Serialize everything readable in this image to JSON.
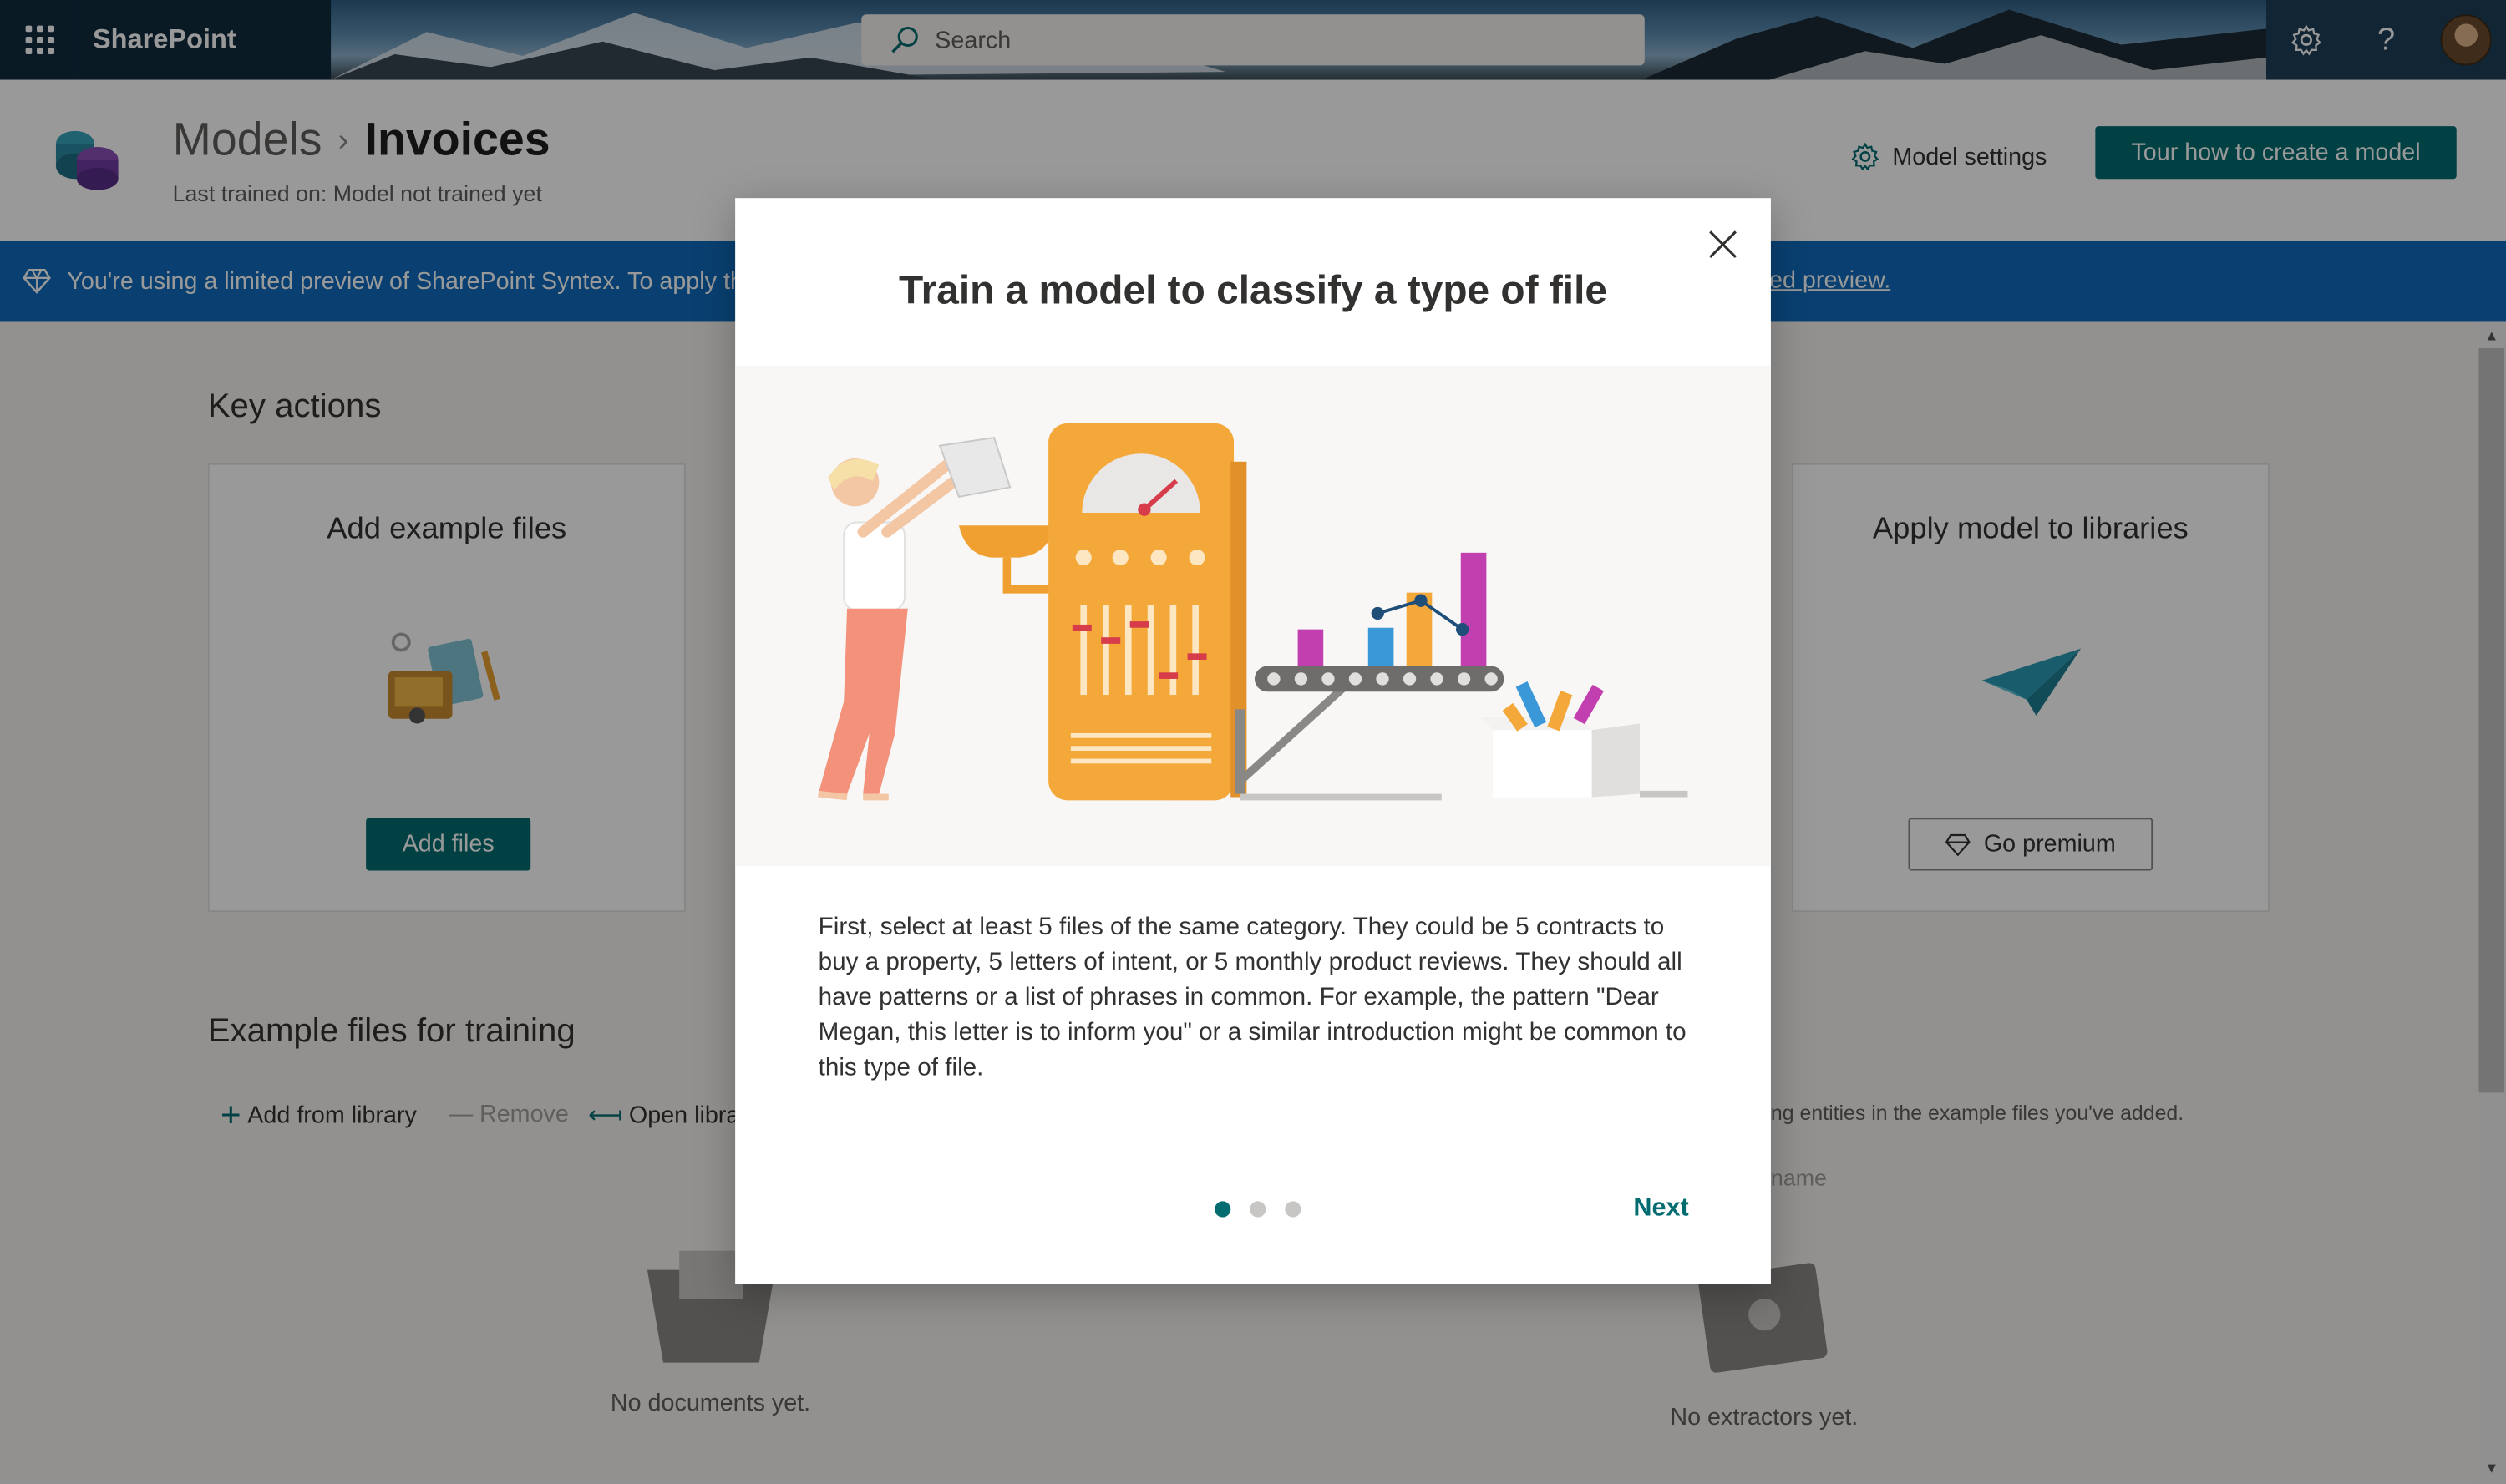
{
  "suite": {
    "app_name": "SharePoint Syntex",
    "search_placeholder": "Search",
    "icons": [
      "waffle-icon",
      "settings-icon",
      "help-icon",
      "user-avatar"
    ]
  },
  "header": {
    "breadcrumb_root": "Models",
    "breadcrumb_current": "Invoices",
    "last_trained": "Last trained on: Model not trained yet",
    "model_settings_label": "Model settings",
    "tour_button_label": "Tour how to create a model"
  },
  "banner": {
    "text": "You're using a limited preview of SharePoint Syntex. To apply the",
    "link_text": "ed preview."
  },
  "key_actions": {
    "heading": "Key actions",
    "add_card": {
      "title": "Add example files",
      "button": "Add files"
    },
    "apply_card": {
      "title": "Apply model to libraries",
      "button": "Go premium"
    }
  },
  "examples": {
    "heading": "Example files for training",
    "commands": {
      "add": "Add from library",
      "remove": "Remove",
      "open": "Open librar"
    },
    "empty_docs": "No documents yet.",
    "extractor_hint": "ng entities in the example files you've added.",
    "extractor_column": "name",
    "empty_extractors": "No extractors yet."
  },
  "dialog": {
    "title": "Train a model to classify a type of file",
    "body": "First, select at least 5 files of the same category. They could be 5 contracts to buy a property, 5 letters of intent, or 5 monthly product reviews. They should all have patterns or a list of phrases in common. For example, the pattern \"Dear Megan, this letter is to inform you\" or a similar introduction might be common to this type of file.",
    "step_count": 3,
    "current_step": 1,
    "next_label": "Next"
  },
  "colors": {
    "primary": "#036c70",
    "banner": "#0f6cbd",
    "suite_dark": "#0f2c3f"
  }
}
